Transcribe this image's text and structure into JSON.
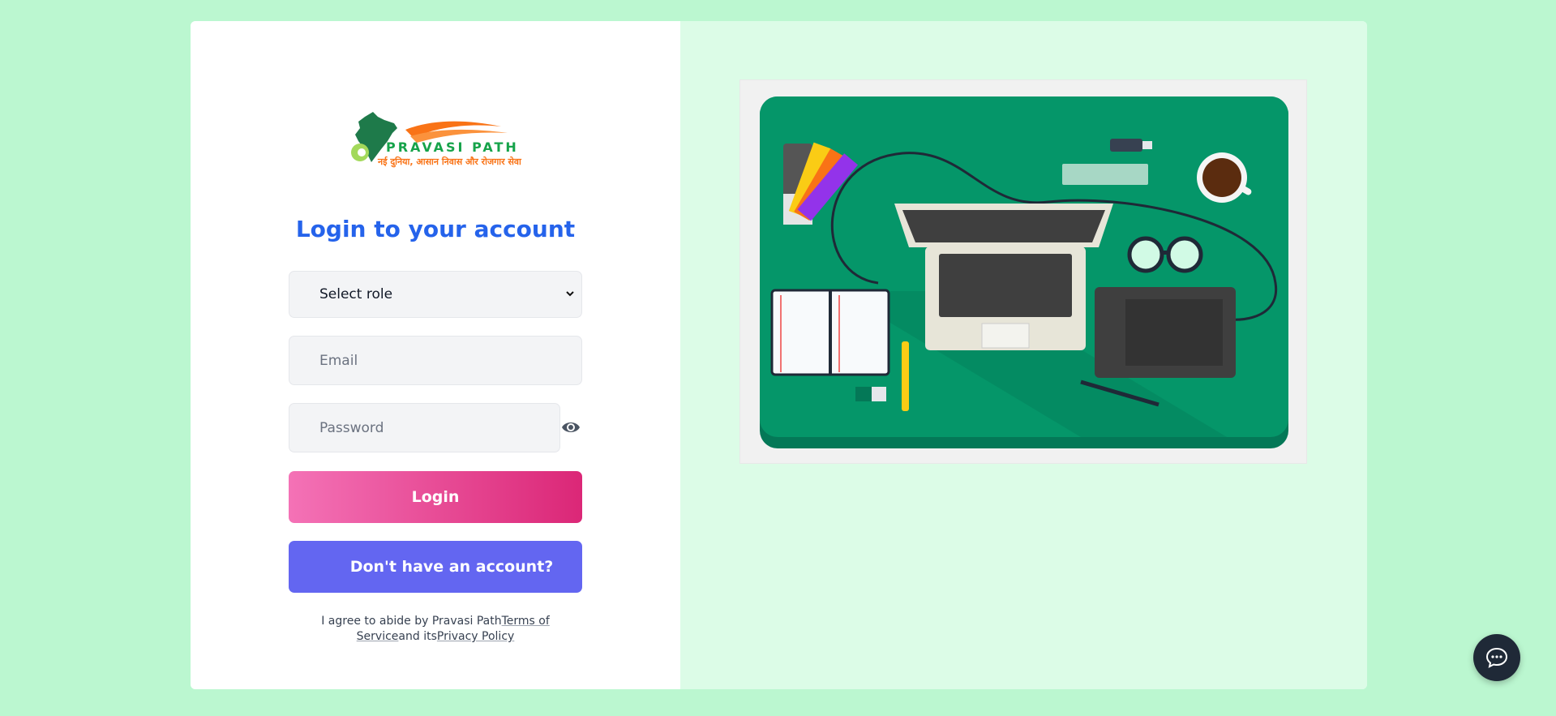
{
  "logo": {
    "brand": "PRAVASI PATH",
    "tagline": "नई दुनिया, आसान निवास और रोजगार सेवा"
  },
  "login": {
    "title": "Login to your account",
    "role_select": {
      "selected": "Select role"
    },
    "email": {
      "placeholder": "Email"
    },
    "password": {
      "placeholder": "Password"
    },
    "login_button": "Login",
    "signup_button": "Don't have an account?",
    "terms": {
      "prefix": "I agree to abide by Pravasi Path",
      "tos_link": "Terms of Service",
      "middle": "and its",
      "privacy_link": "Privacy Policy"
    }
  },
  "icons": {
    "eye": "eye-icon",
    "chevron": "chevron-down-icon",
    "chat": "chat-icon"
  },
  "colors": {
    "page_bg": "#bbf7d0",
    "panel_bg": "#dcfce7",
    "title": "#2563eb",
    "login_gradient_start": "#f472b6",
    "login_gradient_end": "#db2777",
    "signup_bg": "#6366f1",
    "illustration_bg": "#059669"
  }
}
